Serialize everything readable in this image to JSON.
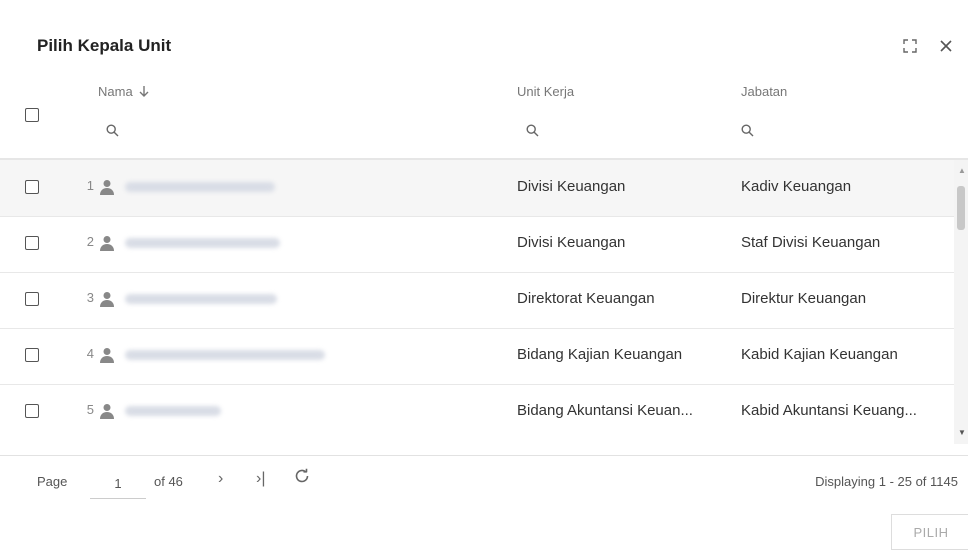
{
  "dialog": {
    "title": "Pilih Kepala Unit"
  },
  "columns": {
    "nama": "Nama",
    "unit_kerja": "Unit Kerja",
    "jabatan": "Jabatan"
  },
  "rows": [
    {
      "no": "1",
      "unit": "Divisi Keuangan",
      "jabatan": "Kadiv Keuangan"
    },
    {
      "no": "2",
      "unit": "Divisi Keuangan",
      "jabatan": "Staf Divisi Keuangan"
    },
    {
      "no": "3",
      "unit": "Direktorat Keuangan",
      "jabatan": "Direktur Keuangan"
    },
    {
      "no": "4",
      "unit": "Bidang Kajian Keuangan",
      "jabatan": "Kabid Kajian Keuangan"
    },
    {
      "no": "5",
      "unit": "Bidang Akuntansi Keuan...",
      "jabatan": "Kabid Akuntansi Keuang..."
    }
  ],
  "pager": {
    "page_label": "Page",
    "page_value": "1",
    "of_label": "of 46",
    "next": "›",
    "last": "›|",
    "display": "Displaying 1 - 25 of 1145"
  },
  "footer": {
    "pilih_label": "PILIH"
  },
  "icons": {
    "expand": "expand-icon",
    "close": "close-icon",
    "search": "search-icon",
    "person": "person-icon",
    "refresh": "refresh-icon"
  }
}
